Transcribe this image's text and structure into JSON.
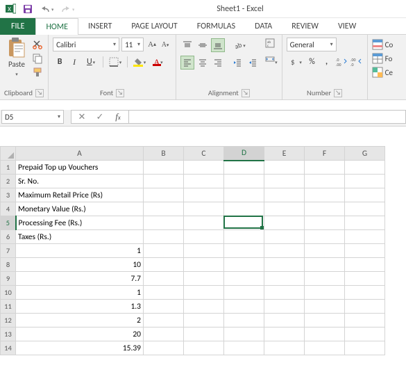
{
  "title": "Sheet1 - Excel",
  "tabs": {
    "file": "FILE",
    "home": "HOME",
    "insert": "INSERT",
    "pagelayout": "PAGE LAYOUT",
    "formulas": "FORMULAS",
    "data": "DATA",
    "review": "REVIEW",
    "view": "VIEW"
  },
  "clipboard": {
    "paste": "Paste",
    "label": "Clipboard"
  },
  "font": {
    "name": "Calibri",
    "size": "11",
    "label": "Font",
    "bold": "B",
    "italic": "I",
    "underline": "U"
  },
  "alignment": {
    "label": "Alignment"
  },
  "number": {
    "format": "General",
    "label": "Number",
    "percent": "%",
    "comma": ",",
    "inc": ".0→.00",
    "dec": ".00→.0"
  },
  "cells": {
    "cond": "Co",
    "form": "Fo",
    "cell": "Ce"
  },
  "namebox": "D5",
  "columns": [
    "A",
    "B",
    "C",
    "D",
    "E",
    "F",
    "G"
  ],
  "rows": [
    {
      "n": "1",
      "a": "Prepaid Top up Vouchers",
      "cls": "txt"
    },
    {
      "n": "2",
      "a": "Sr. No.",
      "cls": "txt"
    },
    {
      "n": "3",
      "a": "Maximum Retail Price (Rs)",
      "cls": "txt"
    },
    {
      "n": "4",
      "a": "Monetary Value (Rs.)",
      "cls": "txt"
    },
    {
      "n": "5",
      "a": "Processing Fee (Rs.)",
      "cls": "txt"
    },
    {
      "n": "6",
      "a": "Taxes (Rs.)",
      "cls": "txt"
    },
    {
      "n": "7",
      "a": "1",
      "cls": "num"
    },
    {
      "n": "8",
      "a": "10",
      "cls": "num"
    },
    {
      "n": "9",
      "a": "7.7",
      "cls": "num"
    },
    {
      "n": "10",
      "a": "1",
      "cls": "num"
    },
    {
      "n": "11",
      "a": "1.3",
      "cls": "num"
    },
    {
      "n": "12",
      "a": "2",
      "cls": "num"
    },
    {
      "n": "13",
      "a": "20",
      "cls": "num"
    },
    {
      "n": "14",
      "a": "15.39",
      "cls": "num"
    }
  ],
  "active": {
    "col": "D",
    "row": "5"
  }
}
